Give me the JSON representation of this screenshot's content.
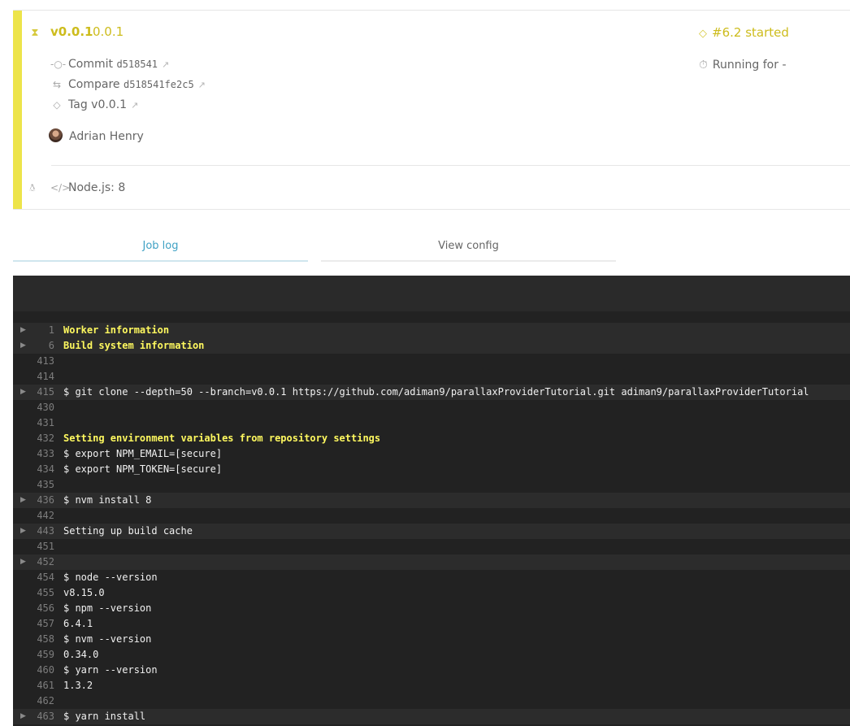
{
  "job": {
    "number": "v0.0.1",
    "name": "0.0.1",
    "commit_label": "Commit",
    "commit_sha": "d518541",
    "compare_label": "Compare",
    "compare_range": "d518541fe2c5",
    "tag_label": "Tag",
    "tag_value": "v0.0.1",
    "author": "Adrian Henry",
    "language": "Node.js: 8",
    "build_status": "#6.2 started",
    "duration": "Running for -",
    "status_color": "#ede44a",
    "accent_color": "#cdbc1c"
  },
  "icons": {
    "status": "hourglass-icon",
    "commit": "commit-icon",
    "compare": "compare-icon",
    "tag": "tag-icon",
    "external": "external-link-icon",
    "os": "linux-icon",
    "language": "code-icon",
    "build": "tag-icon",
    "duration": "stopwatch-icon"
  },
  "tabs": [
    {
      "label": "Job log",
      "active": true
    },
    {
      "label": "View config",
      "active": false
    }
  ],
  "log": [
    {
      "no": "1",
      "text": "Worker information",
      "fold": true,
      "yellow": true
    },
    {
      "no": "6",
      "text": "Build system information",
      "fold": true,
      "yellow": true
    },
    {
      "no": "413",
      "text": "",
      "fold": false,
      "yellow": false
    },
    {
      "no": "414",
      "text": "",
      "fold": false,
      "yellow": false
    },
    {
      "no": "415",
      "text": "$ git clone --depth=50 --branch=v0.0.1 https://github.com/adiman9/parallaxProviderTutorial.git adiman9/parallaxProviderTutorial",
      "fold": true,
      "yellow": false
    },
    {
      "no": "430",
      "text": "",
      "fold": false,
      "yellow": false
    },
    {
      "no": "431",
      "text": "",
      "fold": false,
      "yellow": false
    },
    {
      "no": "432",
      "text": "Setting environment variables from repository settings",
      "fold": false,
      "yellow": true
    },
    {
      "no": "433",
      "text": "$ export NPM_EMAIL=[secure]",
      "fold": false,
      "yellow": false
    },
    {
      "no": "434",
      "text": "$ export NPM_TOKEN=[secure]",
      "fold": false,
      "yellow": false
    },
    {
      "no": "435",
      "text": "",
      "fold": false,
      "yellow": false
    },
    {
      "no": "436",
      "text": "$ nvm install 8",
      "fold": true,
      "yellow": false
    },
    {
      "no": "442",
      "text": "",
      "fold": false,
      "yellow": false
    },
    {
      "no": "443",
      "text": "Setting up build cache",
      "fold": true,
      "yellow": false
    },
    {
      "no": "451",
      "text": "",
      "fold": false,
      "yellow": false
    },
    {
      "no": "452",
      "text": "",
      "fold": true,
      "yellow": false
    },
    {
      "no": "454",
      "text": "$ node --version",
      "fold": false,
      "yellow": false
    },
    {
      "no": "455",
      "text": "v8.15.0",
      "fold": false,
      "yellow": false
    },
    {
      "no": "456",
      "text": "$ npm --version",
      "fold": false,
      "yellow": false
    },
    {
      "no": "457",
      "text": "6.4.1",
      "fold": false,
      "yellow": false
    },
    {
      "no": "458",
      "text": "$ nvm --version",
      "fold": false,
      "yellow": false
    },
    {
      "no": "459",
      "text": "0.34.0",
      "fold": false,
      "yellow": false
    },
    {
      "no": "460",
      "text": "$ yarn --version",
      "fold": false,
      "yellow": false
    },
    {
      "no": "461",
      "text": "1.3.2",
      "fold": false,
      "yellow": false
    },
    {
      "no": "462",
      "text": "",
      "fold": false,
      "yellow": false
    },
    {
      "no": "463",
      "text": "$ yarn install",
      "fold": true,
      "yellow": false
    }
  ]
}
